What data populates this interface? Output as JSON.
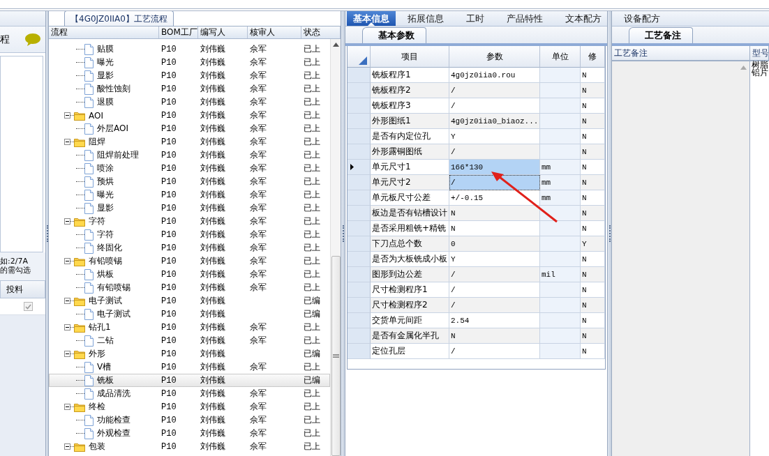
{
  "left_panel": {
    "title": "程",
    "note_lines": [
      "如:2/7A",
      "的需勾选"
    ],
    "column": "投料",
    "rows": [
      {
        "checked": true,
        "disabled": true
      }
    ]
  },
  "flow_panel": {
    "title": "【4G0JZ0IIA0】工艺流程",
    "columns": [
      "流程",
      "BOM工厂",
      "编写人",
      "核审人",
      "状态"
    ],
    "tree": [
      {
        "children": [
          {
            "label": "贴膜",
            "kind": "file",
            "bom": "P10",
            "author": "刘伟巍",
            "reviewer": "佘军",
            "status": "已上",
            "selected": false
          },
          {
            "label": "曝光",
            "kind": "file",
            "bom": "P10",
            "author": "刘伟巍",
            "reviewer": "佘军",
            "status": "已上",
            "selected": false
          },
          {
            "label": "显影",
            "kind": "file",
            "bom": "P10",
            "author": "刘伟巍",
            "reviewer": "佘军",
            "status": "已上",
            "selected": false
          },
          {
            "label": "酸性蚀刻",
            "kind": "file",
            "bom": "P10",
            "author": "刘伟巍",
            "reviewer": "佘军",
            "status": "已上",
            "selected": false
          },
          {
            "label": "退膜",
            "kind": "file",
            "bom": "P10",
            "author": "刘伟巍",
            "reviewer": "佘军",
            "status": "已上",
            "selected": false
          }
        ]
      },
      {
        "label": "AOI",
        "kind": "folder",
        "expanded": true,
        "bom": "P10",
        "author": "刘伟巍",
        "reviewer": "佘军",
        "status": "已上",
        "selected": false,
        "children": [
          {
            "label": "外层AOI",
            "kind": "file",
            "bom": "P10",
            "author": "刘伟巍",
            "reviewer": "佘军",
            "status": "已上",
            "selected": false
          }
        ]
      },
      {
        "label": "阻焊",
        "kind": "folder",
        "expanded": true,
        "bom": "P10",
        "author": "刘伟巍",
        "reviewer": "佘军",
        "status": "已上",
        "selected": false,
        "children": [
          {
            "label": "阻焊前处理",
            "kind": "file",
            "bom": "P10",
            "author": "刘伟巍",
            "reviewer": "佘军",
            "status": "已上",
            "selected": false
          },
          {
            "label": "喷涂",
            "kind": "file",
            "bom": "P10",
            "author": "刘伟巍",
            "reviewer": "佘军",
            "status": "已上",
            "selected": false
          },
          {
            "label": "预烘",
            "kind": "file",
            "bom": "P10",
            "author": "刘伟巍",
            "reviewer": "佘军",
            "status": "已上",
            "selected": false
          },
          {
            "label": "曝光",
            "kind": "file",
            "bom": "P10",
            "author": "刘伟巍",
            "reviewer": "佘军",
            "status": "已上",
            "selected": false
          },
          {
            "label": "显影",
            "kind": "file",
            "bom": "P10",
            "author": "刘伟巍",
            "reviewer": "佘军",
            "status": "已上",
            "selected": false
          }
        ]
      },
      {
        "label": "字符",
        "kind": "folder",
        "expanded": true,
        "bom": "P10",
        "author": "刘伟巍",
        "reviewer": "佘军",
        "status": "已上",
        "selected": false,
        "children": [
          {
            "label": "字符",
            "kind": "file",
            "bom": "P10",
            "author": "刘伟巍",
            "reviewer": "佘军",
            "status": "已上",
            "selected": false
          },
          {
            "label": "终固化",
            "kind": "file",
            "bom": "P10",
            "author": "刘伟巍",
            "reviewer": "佘军",
            "status": "已上",
            "selected": false
          }
        ]
      },
      {
        "label": "有铅喷锡",
        "kind": "folder",
        "expanded": true,
        "bom": "P10",
        "author": "刘伟巍",
        "reviewer": "佘军",
        "status": "已上",
        "selected": false,
        "children": [
          {
            "label": "烘板",
            "kind": "file",
            "bom": "P10",
            "author": "刘伟巍",
            "reviewer": "佘军",
            "status": "已上",
            "selected": false
          },
          {
            "label": "有铅喷锡",
            "kind": "file",
            "bom": "P10",
            "author": "刘伟巍",
            "reviewer": "佘军",
            "status": "已上",
            "selected": false
          }
        ]
      },
      {
        "label": "电子测试",
        "kind": "folder",
        "expanded": true,
        "bom": "P10",
        "author": "刘伟巍",
        "status": "已编",
        "selected": false,
        "children": [
          {
            "label": "电子测试",
            "kind": "file",
            "bom": "P10",
            "author": "刘伟巍",
            "status": "已编",
            "selected": false
          }
        ]
      },
      {
        "label": "钻孔1",
        "kind": "folder",
        "expanded": true,
        "bom": "P10",
        "author": "刘伟巍",
        "reviewer": "佘军",
        "status": "已上",
        "selected": false,
        "children": [
          {
            "label": "二钻",
            "kind": "file",
            "bom": "P10",
            "author": "刘伟巍",
            "reviewer": "佘军",
            "status": "已上",
            "selected": false
          }
        ]
      },
      {
        "label": "外形",
        "kind": "folder",
        "expanded": true,
        "bom": "P10",
        "author": "刘伟巍",
        "status": "已编",
        "selected": false,
        "children": [
          {
            "label": "V槽",
            "kind": "file",
            "bom": "P10",
            "author": "刘伟巍",
            "reviewer": "佘军",
            "status": "已上",
            "selected": false
          },
          {
            "label": "铣板",
            "kind": "file",
            "bom": "P10",
            "author": "刘伟巍",
            "status": "已编",
            "selected": true
          },
          {
            "label": "成品清洗",
            "kind": "file",
            "bom": "P10",
            "author": "刘伟巍",
            "reviewer": "佘军",
            "status": "已上",
            "selected": false
          }
        ]
      },
      {
        "label": "终检",
        "kind": "folder",
        "expanded": true,
        "bom": "P10",
        "author": "刘伟巍",
        "reviewer": "佘军",
        "status": "已上",
        "selected": false,
        "children": [
          {
            "label": "功能检查",
            "kind": "file",
            "bom": "P10",
            "author": "刘伟巍",
            "reviewer": "佘军",
            "status": "已上",
            "selected": false
          },
          {
            "label": "外观检查",
            "kind": "file",
            "bom": "P10",
            "author": "刘伟巍",
            "reviewer": "佘军",
            "status": "已上",
            "selected": false
          }
        ]
      },
      {
        "label": "包装",
        "kind": "folder",
        "expanded": true,
        "bom": "P10",
        "author": "刘伟巍",
        "reviewer": "佘军",
        "status": "已上",
        "selected": false
      }
    ]
  },
  "detail_tabs": [
    {
      "label": "基本信息",
      "selected": true
    },
    {
      "label": "拓展信息",
      "selected": false
    },
    {
      "label": "工时",
      "selected": false
    },
    {
      "label": "产品特性",
      "selected": false
    },
    {
      "label": "文本配方",
      "selected": false
    },
    {
      "label": "设备配方",
      "selected": false
    }
  ],
  "param_panel": {
    "tab": "基本参数",
    "columns": [
      "项目",
      "参数",
      "单位",
      "修"
    ],
    "rows": [
      {
        "item": "铣板程序1",
        "value": "4g0jz0iia0.rou",
        "modified": "N",
        "selected": false,
        "focused": false
      },
      {
        "item": "铣板程序2",
        "value": "/",
        "modified": "N",
        "selected": false,
        "focused": false
      },
      {
        "item": "铣板程序3",
        "value": "/",
        "modified": "N",
        "selected": false,
        "focused": false
      },
      {
        "item": "外形图纸1",
        "value": "4g0jz0iia0_biaoz...",
        "modified": "N",
        "selected": false,
        "focused": false
      },
      {
        "item": "是否有内定位孔",
        "value": "Y",
        "modified": "N",
        "selected": false,
        "focused": false
      },
      {
        "item": "外形露铜图纸",
        "value": "/",
        "modified": "N",
        "selected": false,
        "focused": false
      },
      {
        "item": "单元尺寸1",
        "value": "166*130",
        "unit": "mm",
        "modified": "N",
        "selected": true,
        "focused": false
      },
      {
        "item": "单元尺寸2",
        "value": "/",
        "unit": "mm",
        "modified": "N",
        "selected": false,
        "focused": true
      },
      {
        "item": "单元板尺寸公差",
        "value": "+/-0.15",
        "unit": "mm",
        "modified": "N",
        "selected": false,
        "focused": false
      },
      {
        "item": "板边是否有钻槽设计",
        "value": "N",
        "modified": "N",
        "selected": false,
        "focused": false
      },
      {
        "item": "是否采用粗铣+精铣",
        "value": "N",
        "modified": "N",
        "selected": false,
        "focused": false
      },
      {
        "item": "下刀点总个数",
        "value": "0",
        "modified": "Y",
        "selected": false,
        "focused": false
      },
      {
        "item": "是否为大板铣成小板",
        "value": "Y",
        "modified": "N",
        "selected": false,
        "focused": false
      },
      {
        "item": "图形到边公差",
        "value": "/",
        "unit": "mil",
        "modified": "N",
        "selected": false,
        "focused": false
      },
      {
        "item": "尺寸检测程序1",
        "value": "/",
        "modified": "N",
        "selected": false,
        "focused": false
      },
      {
        "item": "尺寸检测程序2",
        "value": "/",
        "modified": "N",
        "selected": false,
        "focused": false
      },
      {
        "item": "交货单元间距",
        "value": "2.54",
        "modified": "N",
        "selected": false,
        "focused": false
      },
      {
        "item": "是否有金属化半孔",
        "value": "N",
        "modified": "N",
        "selected": false,
        "focused": false
      },
      {
        "item": "定位孔层",
        "value": "/",
        "modified": "N",
        "selected": false,
        "focused": false
      }
    ]
  },
  "notes_panel": {
    "tab": "工艺备注",
    "columns": [
      "工艺备注",
      "型号"
    ],
    "model_text": "树脂铝片"
  }
}
